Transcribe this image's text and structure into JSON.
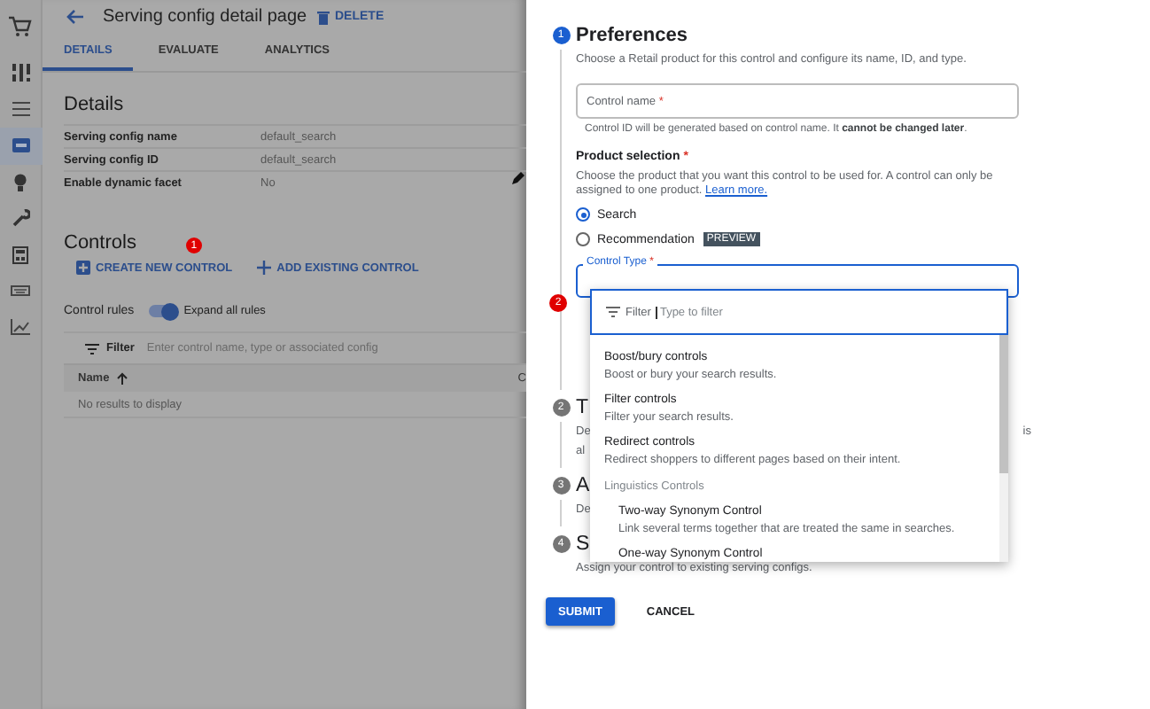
{
  "sidebar": {
    "items": [
      {
        "kind": "cart",
        "selected": false
      },
      {
        "kind": "dashboard",
        "selected": false
      },
      {
        "kind": "list",
        "selected": false
      },
      {
        "kind": "card",
        "selected": true
      },
      {
        "kind": "bulb",
        "selected": false
      },
      {
        "kind": "wrench",
        "selected": false
      },
      {
        "kind": "calculator",
        "selected": false
      },
      {
        "kind": "keyboard",
        "selected": false
      },
      {
        "kind": "chart",
        "selected": false
      }
    ]
  },
  "page": {
    "title": "Serving config detail page",
    "delete_button": "DELETE",
    "tabs": [
      {
        "label": "DETAILS",
        "selected": true
      },
      {
        "label": "EVALUATE",
        "selected": false
      },
      {
        "label": "ANALYTICS",
        "selected": false
      }
    ],
    "details": {
      "heading": "Details",
      "rows": [
        {
          "label": "Serving config name",
          "value": "default_search"
        },
        {
          "label": "Serving config ID",
          "value": "default_search"
        },
        {
          "label": "Enable dynamic facet",
          "value": "No"
        }
      ]
    },
    "controls": {
      "heading": "Controls",
      "annotation": "1",
      "create_button": "CREATE NEW CONTROL",
      "add_button": "ADD EXISTING CONTROL",
      "rules_label": "Control rules",
      "expand_toggle": {
        "label": "Expand all rules",
        "on": true
      },
      "filter": {
        "label": "Filter",
        "placeholder": "Enter control name, type or associated config"
      },
      "table": {
        "columns": [
          "Name",
          "C"
        ],
        "empty_text": "No results to display"
      }
    }
  },
  "panel": {
    "steps": [
      {
        "number": "1",
        "title": "Preferences",
        "active": true,
        "description_lines": [
          {
            "left": "Choose a Retail product for this control and configure its name, ID, and type."
          }
        ]
      },
      {
        "number": "2",
        "title": "T",
        "active": false,
        "description_lines": [
          {
            "left": "De",
            "right": "is"
          },
          {
            "left": "al"
          }
        ]
      },
      {
        "number": "3",
        "title": "A",
        "active": false,
        "description_lines": [
          {
            "left": "De"
          }
        ]
      },
      {
        "number": "4",
        "title": "S",
        "active": false,
        "description_lines": [
          {
            "left": "Assign your control to existing serving configs."
          }
        ]
      }
    ],
    "preferences": {
      "control_name": {
        "label": "Control name",
        "required_mark": "*",
        "helper": "Control ID will be generated based on control name. It **cannot be changed later**."
      },
      "product_selection": {
        "label": "Product selection",
        "required_mark": "*",
        "description": "Choose the product that you want this control to be used for. A control can only be assigned to one product.",
        "link": "Learn more.",
        "options": [
          {
            "label": "Search",
            "selected": true
          },
          {
            "label": "Recommendation",
            "selected": false,
            "badge": "PREVIEW"
          }
        ]
      },
      "control_type": {
        "label": "Control Type",
        "required_mark": "*",
        "annotation": "2",
        "filter": {
          "label": "Filter",
          "placeholder": "Type to filter"
        },
        "menu": [
          {
            "kind": "option",
            "title": "Boost/bury controls",
            "description": "Boost or bury your search results."
          },
          {
            "kind": "option",
            "title": "Filter controls",
            "description": "Filter your search results."
          },
          {
            "kind": "option",
            "title": "Redirect controls",
            "description": "Redirect shoppers to different pages based on their intent."
          },
          {
            "kind": "group",
            "title": "Linguistics Controls"
          },
          {
            "kind": "sub_option",
            "title": "Two-way Synonym Control",
            "description": "Link several terms together that are treated the same in searches."
          },
          {
            "kind": "sub_option",
            "title": "One-way Synonym Control"
          }
        ]
      }
    },
    "submit_button": "SUBMIT",
    "cancel_button": "CANCEL"
  }
}
